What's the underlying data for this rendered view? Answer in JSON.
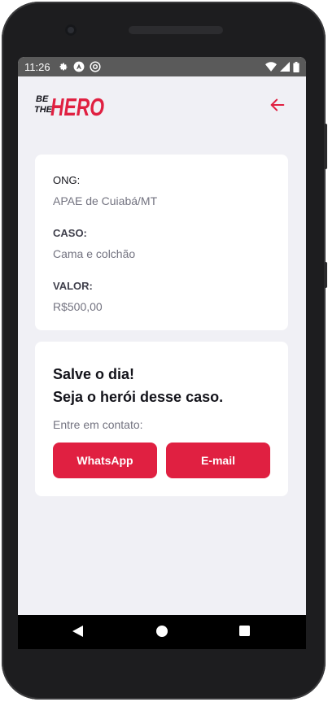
{
  "status_bar": {
    "time": "11:26",
    "icons": [
      "settings-gear-icon",
      "a-circle-icon",
      "sync-circle-icon"
    ],
    "right_icons": [
      "wifi-icon",
      "signal-icon",
      "battery-icon"
    ]
  },
  "header": {
    "logo_top": "BE",
    "logo_mid": "THE",
    "logo_main": "HERO",
    "back_icon": "arrow-left-icon"
  },
  "incident": {
    "ong_label": "ONG:",
    "ong_value": "APAE de Cuiabá/MT",
    "case_label": "CASO:",
    "case_value": "Cama e colchão",
    "value_label": "VALOR:",
    "value_value": "R$500,00"
  },
  "contact": {
    "title_line1": "Salve o dia!",
    "title_line2": "Seja o herói desse caso.",
    "description": "Entre em contato:",
    "whatsapp_label": "WhatsApp",
    "email_label": "E-mail"
  },
  "nav": {
    "back": "back-triangle-icon",
    "home": "home-circle-icon",
    "recents": "recents-square-icon"
  },
  "colors": {
    "accent": "#e02041",
    "background": "#f0f0f5",
    "title": "#13131a",
    "text": "#737380"
  }
}
